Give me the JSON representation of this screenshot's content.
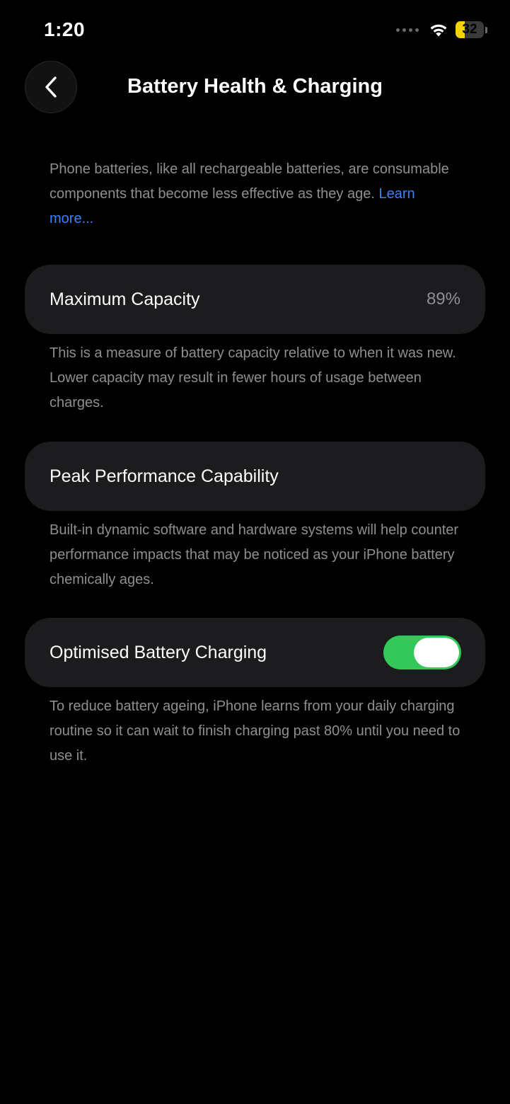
{
  "status_bar": {
    "time": "1:20",
    "battery_level": "32",
    "battery_fraction": 0.32,
    "battery_color": "#f5d20a",
    "icons": [
      "signal-dots-icon",
      "wifi-icon",
      "battery-icon"
    ]
  },
  "nav": {
    "title": "Battery Health & Charging",
    "back_icon": "chevron-left-icon"
  },
  "intro": {
    "text": "Phone batteries, like all rechargeable batteries, are consumable components that become less effective as they age. ",
    "link_label": "Learn more..."
  },
  "max_capacity": {
    "label": "Maximum Capacity",
    "value": "89%",
    "footnote": "This is a measure of battery capacity relative to when it was new. Lower capacity may result in fewer hours of usage between charges."
  },
  "peak_performance": {
    "label": "Peak Performance Capability",
    "footnote": "Built-in dynamic software and hardware systems will help counter performance impacts that may be noticed as your iPhone battery chemically ages."
  },
  "optimised_charging": {
    "label": "Optimised Battery Charging",
    "enabled": true,
    "toggle_color": "#34c759",
    "footnote": "To reduce battery ageing, iPhone learns from your daily charging routine so it can wait to finish charging past 80% until you need to use it."
  },
  "colors": {
    "background": "#000000",
    "card": "#1c1c1e",
    "secondary_text": "#8e8e93",
    "link": "#3b82f6"
  }
}
